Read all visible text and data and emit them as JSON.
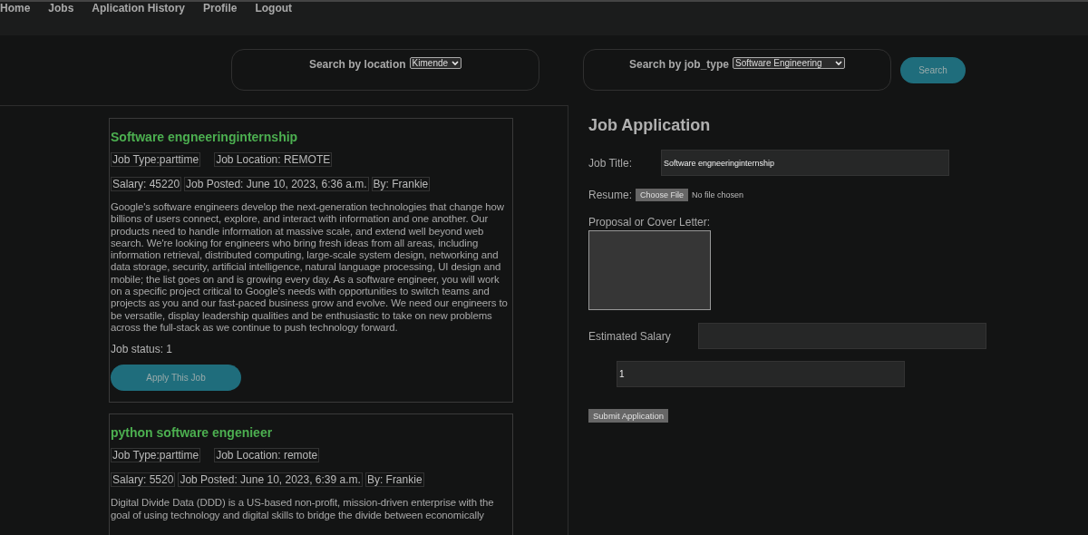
{
  "nav": [
    {
      "label": "Home"
    },
    {
      "label": "Jobs"
    },
    {
      "label": "Aplication History"
    },
    {
      "label": "Profile"
    },
    {
      "label": "Logout"
    }
  ],
  "search": {
    "location_label": "Search by location",
    "location_value": "Kimende",
    "type_label": "Search by job_type",
    "type_value": "Software Engineering",
    "button": "Search"
  },
  "jobs": [
    {
      "title": "Software engneeringinternship",
      "job_type": "Job Type:parttime",
      "location": "Job Location: REMOTE",
      "salary": "Salary: 45220",
      "posted": "Job Posted: June 10, 2023, 6:36 a.m.",
      "by": "By: Frankie",
      "description": "Google's software engineers develop the next-generation technologies that change how billions of users connect, explore, and interact with information and one another. Our products need to handle information at massive scale, and extend well beyond web search. We're looking for engineers who bring fresh ideas from all areas, including information retrieval, distributed computing, large-scale system design, networking and data storage, security, artificial intelligence, natural language processing, UI design and mobile; the list goes on and is growing every day. As a software engineer, you will work on a specific project critical to Google's needs with opportunities to switch teams and projects as you and our fast-paced business grow and evolve. We need our engineers to be versatile, display leadership qualities and be enthusiastic to take on new problems across the full-stack as we continue to push technology forward.",
      "status": "Job status: 1",
      "button": "Apply This Job"
    },
    {
      "title": "python software engenieer",
      "job_type": "Job Type:parttime",
      "location": "Job Location: remote",
      "salary": "Salary: 5520",
      "posted": "Job Posted: June 10, 2023, 6:39 a.m.",
      "by": "By: Frankie",
      "description": "Digital Divide Data (DDD) is a US-based non-profit, mission-driven enterprise with the goal of using technology and digital skills to bridge the divide between economically"
    }
  ],
  "application": {
    "heading": "Job Application",
    "job_title_label": "Job Title:",
    "job_title_value": "Software engneeringinternship",
    "resume_label": "Resume:",
    "file_button": "Choose File",
    "file_status": "No file chosen",
    "letter_label": "Proposal or Cover Letter:",
    "salary_label": "Estimated Salary",
    "extra_value": "1",
    "submit": "Submit Application"
  }
}
